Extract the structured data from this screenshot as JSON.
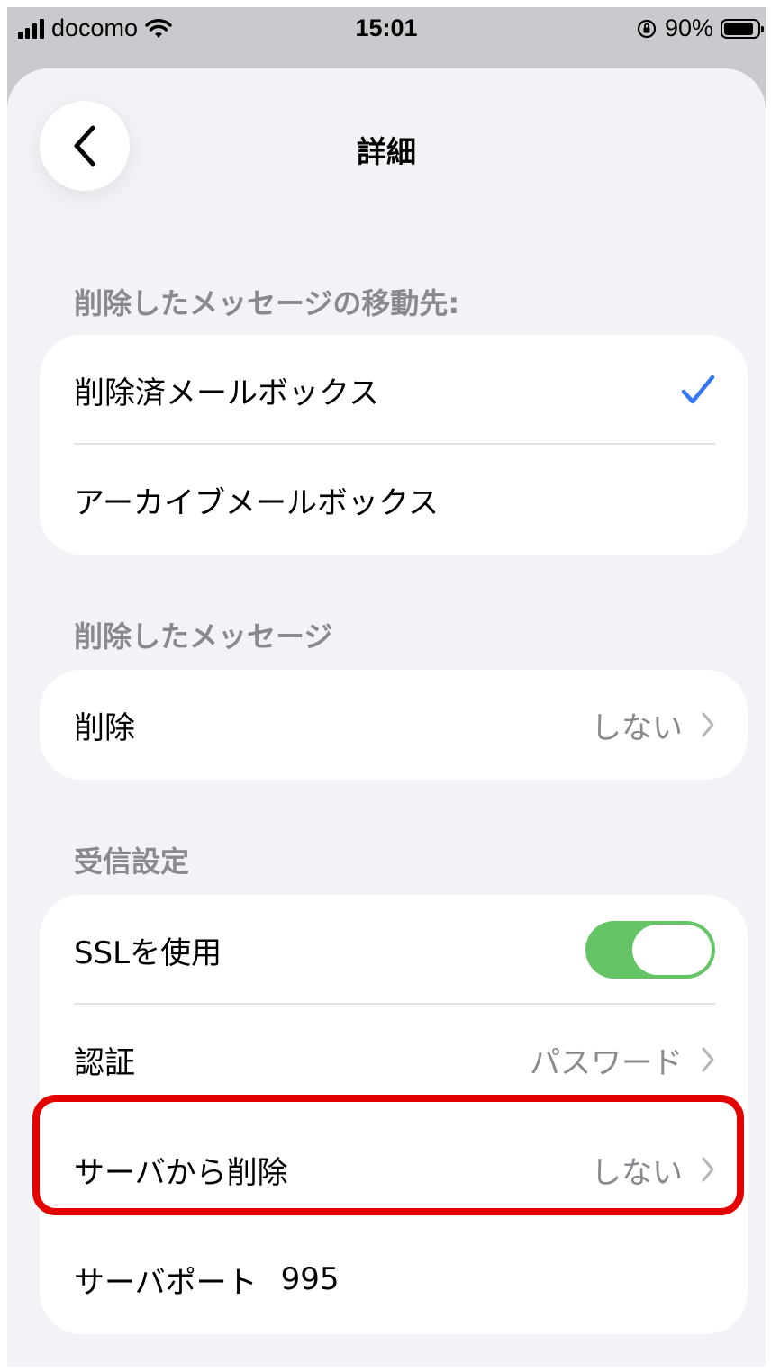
{
  "status_bar": {
    "carrier": "docomo",
    "time": "15:01",
    "battery_percent": "90%",
    "battery_level": 0.9
  },
  "nav": {
    "title": "詳細",
    "back_icon": "chevron-left-icon"
  },
  "section_move": {
    "header": "削除したメッセージの移動先:",
    "options": [
      {
        "label": "削除済メールボックス",
        "selected": true
      },
      {
        "label": "アーカイブメールボックス",
        "selected": false
      }
    ],
    "check_color": "#3478f6"
  },
  "section_deleted": {
    "header": "削除したメッセージ",
    "rows": [
      {
        "label": "削除",
        "value": "しない"
      }
    ]
  },
  "section_incoming": {
    "header": "受信設定",
    "ssl": {
      "label": "SSLを使用",
      "on": true,
      "color": "#65c466"
    },
    "auth": {
      "label": "認証",
      "value": "パスワード"
    },
    "delete_from_server": {
      "label": "サーバから削除",
      "value": "しない"
    },
    "server_port": {
      "label": "サーバポート",
      "value": "995"
    }
  },
  "annotation": {
    "color": "#e50000",
    "target": "サーバから削除"
  }
}
